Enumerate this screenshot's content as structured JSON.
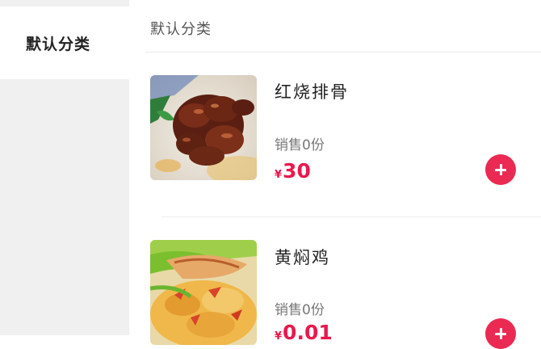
{
  "sidebar": {
    "items": [
      {
        "label": "默认分类",
        "active": true
      }
    ]
  },
  "main": {
    "section_title": "默认分类",
    "products": [
      {
        "name": "红烧排骨",
        "sales": "销售0份",
        "currency": "¥",
        "price": "30",
        "image_icon": "braised-ribs-photo"
      },
      {
        "name": "黄焖鸡",
        "sales": "销售0份",
        "currency": "¥",
        "price": "0.01",
        "image_icon": "braised-chicken-photo"
      }
    ]
  },
  "colors": {
    "accent": "#ea2a52",
    "price": "#e8194d",
    "sidebar_bg": "#f0f0f0"
  }
}
